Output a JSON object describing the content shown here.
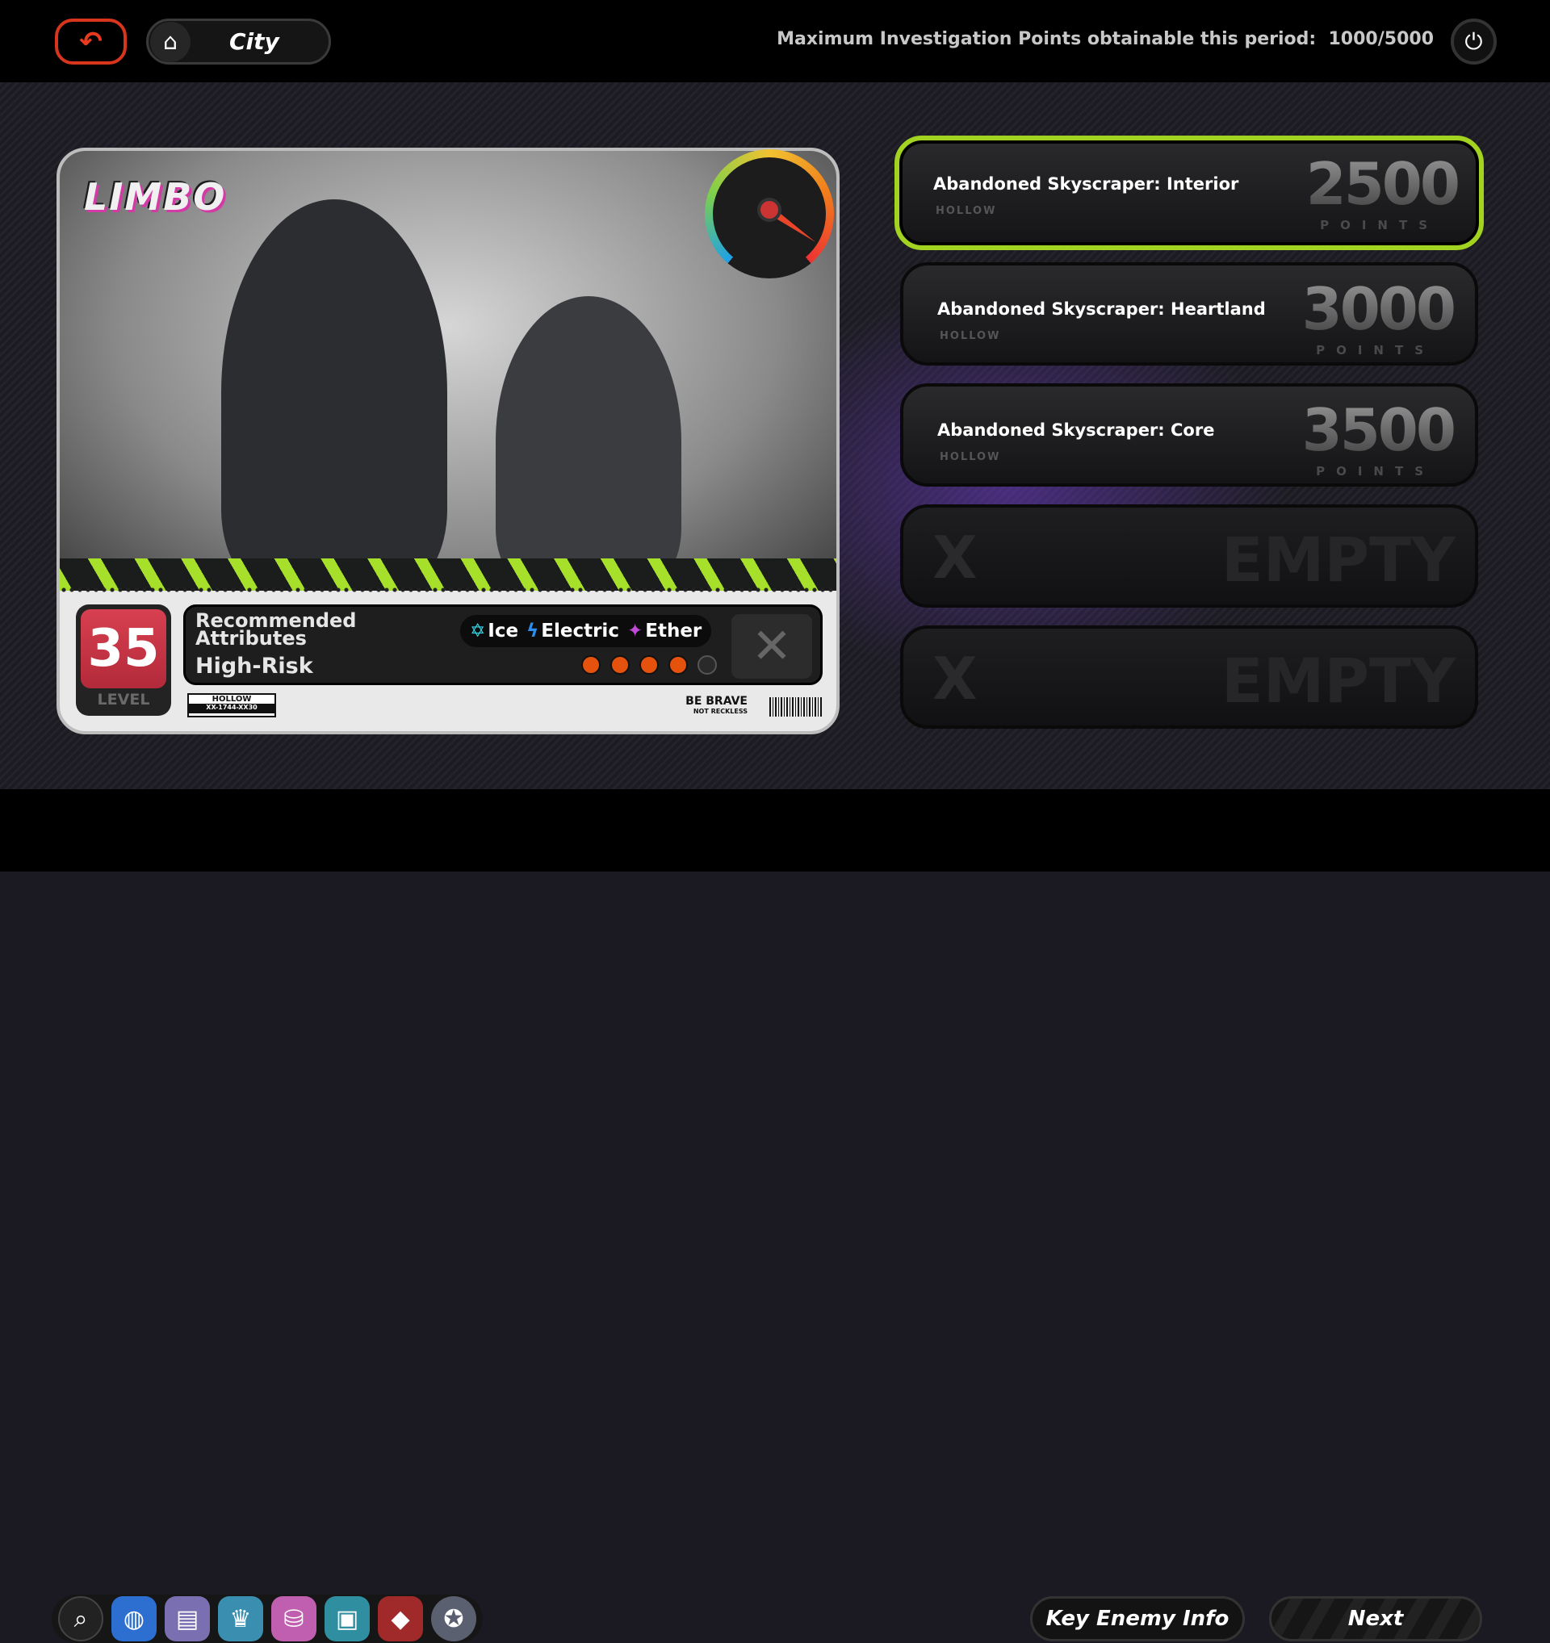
{
  "header": {
    "back_icon": "back-arrow-icon",
    "location": "City",
    "home_icon": "home-icon",
    "max_points_label": "Maximum Investigation Points obtainable this period:",
    "max_points_value": "1000/5000",
    "power_icon": "power-icon"
  },
  "card": {
    "logo": "LIMBO",
    "level": "35",
    "level_label": "LEVEL",
    "recommended_label": "Recommended Attributes",
    "attributes": [
      {
        "name": "Ice",
        "color": "#3ad7e8",
        "icon": "ice-icon"
      },
      {
        "name": "Electric",
        "color": "#2a8ff0",
        "icon": "electric-icon"
      },
      {
        "name": "Ether",
        "color": "#c24ad8",
        "icon": "ether-icon"
      }
    ],
    "risk": "High-Risk",
    "risk_level": 4,
    "risk_max": 5,
    "tag_top": "HOLLOW",
    "tag_code": "XX-1744-XX30",
    "motto": "BE BRAVE",
    "motto_sub": "NOT RECKLESS"
  },
  "commissions": [
    {
      "title": "Abandoned Skyscraper: Interior",
      "type": "HOLLOW",
      "points": "2500",
      "points_label": "POINTS",
      "selected": true
    },
    {
      "title": "Abandoned Skyscraper: Heartland",
      "type": "HOLLOW",
      "points": "3000",
      "points_label": "POINTS"
    },
    {
      "title": "Abandoned Skyscraper: Core",
      "type": "HOLLOW",
      "points": "3500",
      "points_label": "POINTS"
    },
    {
      "empty": true,
      "mark": "X",
      "label": "EMPTY"
    },
    {
      "empty": true,
      "mark": "X",
      "label": "EMPTY"
    }
  ],
  "footer": {
    "key_enemy_label": "Key Enemy Info",
    "next_label": "Next",
    "selection_color": "#a3d321"
  }
}
